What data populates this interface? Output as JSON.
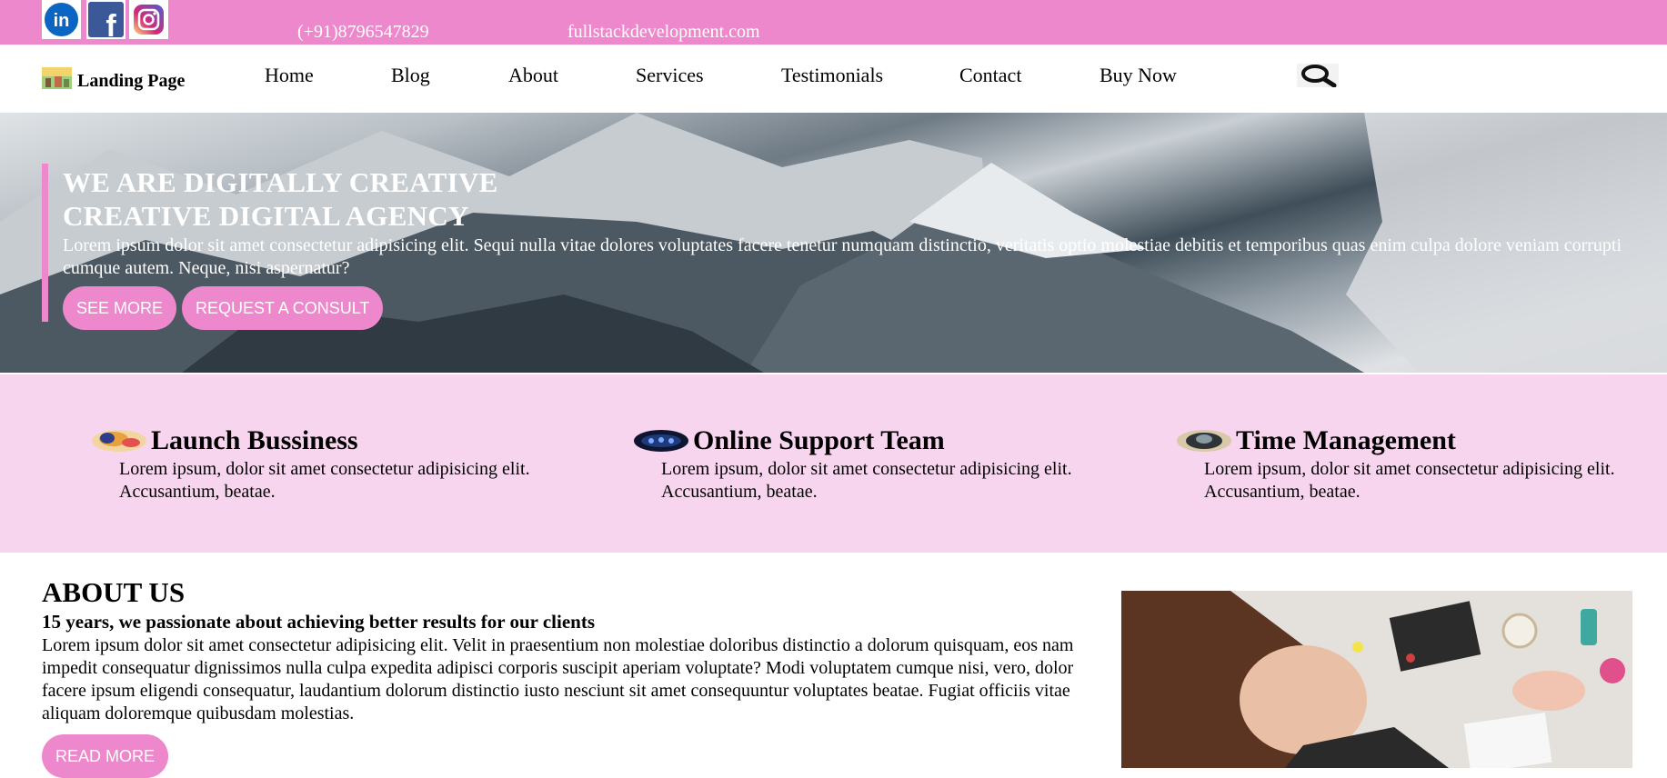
{
  "topbar": {
    "social": [
      "linkedin-icon",
      "facebook-icon",
      "instagram-icon"
    ],
    "phone": "(+91)8796547829",
    "website": "fullstackdevelopment.com"
  },
  "nav": {
    "brand": "Landing Page",
    "items": [
      "Home",
      "Blog",
      "About",
      "Services",
      "Testimonials",
      "Contact",
      "Buy Now"
    ],
    "search_icon": "search-icon"
  },
  "hero": {
    "title_line1": "WE ARE DIGITALLY CREATIVE",
    "title_line2": "CREATIVE DIGITAL AGENCY",
    "text": "Lorem ipsum dolor sit amet consectetur adipisicing elit. Sequi nulla vitae dolores voluptates facere tenetur numquam distinctio, veritatis optio molestiae debitis et temporibus quas enim culpa dolore veniam corrupti cumque autem. Neque, nisi aspernatur?",
    "btn_primary": "SEE MORE",
    "btn_secondary": "REQUEST A CONSULT"
  },
  "features": [
    {
      "title": "Launch Bussiness",
      "text": "Lorem ipsum, dolor sit amet consectetur adipisicing elit. Accusantium, beatae."
    },
    {
      "title": "Online Support Team",
      "text": "Lorem ipsum, dolor sit amet consectetur adipisicing elit. Accusantium, beatae."
    },
    {
      "title": "Time Management",
      "text": "Lorem ipsum, dolor sit amet consectetur adipisicing elit. Accusantium, beatae."
    }
  ],
  "about": {
    "title": "ABOUT US",
    "subtitle": "15 years, we passionate about achieving better results for our clients",
    "text": "Lorem ipsum dolor sit amet consectetur adipisicing elit. Velit in praesentium non molestiae doloribus distinctio a dolorum quisquam, eos nam impedit consequatur dignissimos nulla culpa expedita adipisci corporis suscipit aperiam voluptate? Modi voluptatem cumque nisi, vero, dolor facere ipsum eligendi consequatur, laudantium dolorum distinctio iusto nesciunt sit amet consequuntur voluptates beatae. Fugiat officiis vitae aliquam doloremque quibusdam molestias.",
    "button": "READ MORE"
  },
  "colors": {
    "accent": "#ee88cc",
    "feature_bg": "#f8d5ef",
    "linkedin": "#0a66c2",
    "facebook": "#3b5998"
  }
}
